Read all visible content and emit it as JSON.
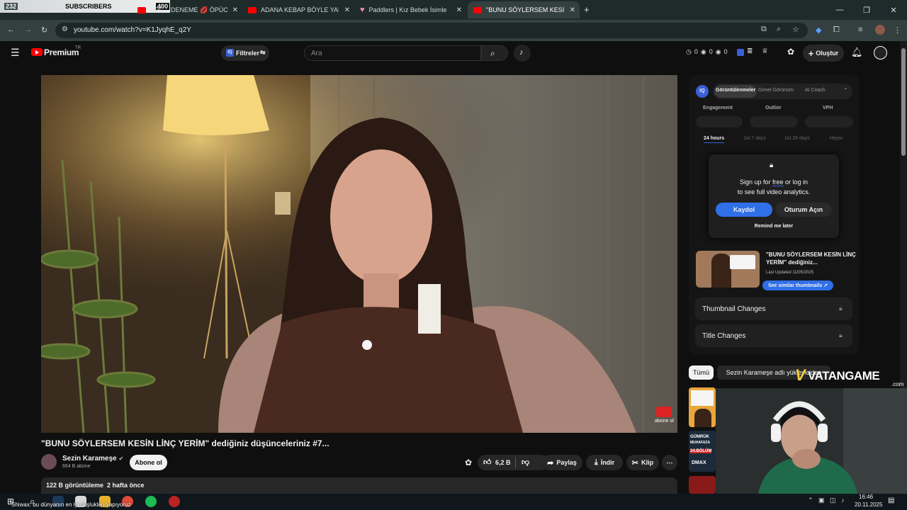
{
  "browser": {
    "overlay": {
      "count_left": "232",
      "subscribers_label": "SUBSCRIBERS",
      "count_right": "400"
    },
    "tabs": [
      {
        "label": "UPC... DENEME 💋 ÖPÜCÜK"
      },
      {
        "label": "ADANA KEBAP BÖYLE YAPILIR"
      },
      {
        "label": "Paddlers | Kız Bebek İsimleri: An"
      },
      {
        "label": "\"BUNU SÖYLERSEM KESİN LİNÇ"
      }
    ],
    "new_tab": "+",
    "url": "youtube.com/watch?v=K1JyqhE_q2Y"
  },
  "yt": {
    "logo_text": "Premium",
    "logo_sup": "TR",
    "filters_label": "Filtreler",
    "search_placeholder": "Ara",
    "counters": [
      "0",
      "0",
      "0"
    ],
    "create_label": "Oluştur"
  },
  "panel": {
    "badge": "IQ",
    "tabs": [
      "Görüntülenmeler",
      "Genel Görünüm",
      "AI Coach"
    ],
    "stats_headers": [
      "Engagement",
      "Outlier",
      "VPH"
    ],
    "time_tabs": [
      "24 hours",
      "1st 7 days",
      "1st 28 days",
      "Hepsi"
    ],
    "signup_text_1": "Sign up for ",
    "signup_free": "free",
    "signup_text_2": " or log in",
    "signup_text_3": "to see full video analytics.",
    "register_label": "Kaydol",
    "login_label": "Oturum Açın",
    "remind_label": "Remind me later",
    "thumb_title": "\"BUNU SÖYLERSEM KESİN LİNÇ YERİM\" dediğiniz...",
    "last_updated": "Last Updated 11/05/2025",
    "similar_label": "See similar thumbnails ↗",
    "thumbnail_changes": "Thumbnail Changes",
    "title_changes": "Title Changes"
  },
  "chips": {
    "all": "Tümü",
    "channel_uploads": "Sezin Karameşe adlı yükleyiciden"
  },
  "watermark": {
    "brand": "VATANGAME",
    "sub": ".com"
  },
  "video": {
    "title": "\"BUNU SÖYLERSEM KESİN LİNÇ YERİM\" dediğiniz düşünceleriniz #7...",
    "channel": "Sezin Karameşe",
    "subs": "664 B abone",
    "subscribe_label": "Abone ol",
    "likes": "6,2 B",
    "share_label": "Paylaş",
    "download_label": "İndir",
    "clip_label": "Klip",
    "views_line": "122 B görüntüleme  2 hafta önce",
    "corner_badge": "abone ol"
  },
  "taskbar": {
    "ticker": "Shiwax: bu dünyanın en iyi duşlukları yapıyoruz",
    "time": "16:46",
    "date": "20.11.2025"
  },
  "side_thumbs": {
    "customs_line1": "GÜMRÜK",
    "customs_line2": "MUHAFAZA",
    "customs_line3": "24.BÖLÜM",
    "customs_line4": "DMAX"
  }
}
